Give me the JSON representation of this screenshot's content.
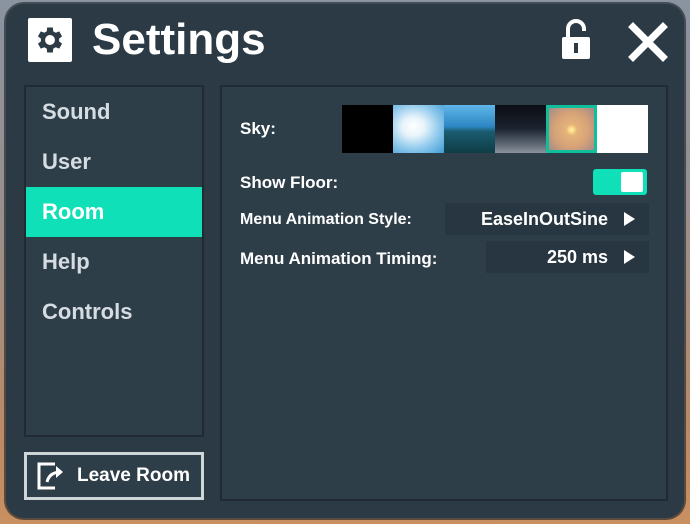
{
  "header": {
    "title": "Settings",
    "icons": {
      "settings": "gear-icon",
      "lock": "unlock-icon",
      "close": "close-icon"
    }
  },
  "sidebar": {
    "items": [
      {
        "label": "Sound"
      },
      {
        "label": "User"
      },
      {
        "label": "Room",
        "active": true
      },
      {
        "label": "Help"
      },
      {
        "label": "Controls"
      }
    ],
    "leave_label": "Leave Room",
    "leave_icon": "exit-icon"
  },
  "room": {
    "sky_label": "Sky:",
    "sky_options": [
      {
        "name": "black",
        "selected": false
      },
      {
        "name": "clouds",
        "selected": false
      },
      {
        "name": "ocean",
        "selected": false
      },
      {
        "name": "dusk",
        "selected": false
      },
      {
        "name": "sunset",
        "selected": true
      },
      {
        "name": "white",
        "selected": false
      }
    ],
    "show_floor_label": "Show Floor:",
    "show_floor": true,
    "anim_style_label": "Menu Animation Style:",
    "anim_style_value": "EaseInOutSine",
    "anim_timing_label": "Menu Animation Timing:",
    "anim_timing_value": "250 ms"
  },
  "colors": {
    "accent": "#0fe0b8",
    "panel": "#2e3e49",
    "window": "#2b3a44"
  }
}
